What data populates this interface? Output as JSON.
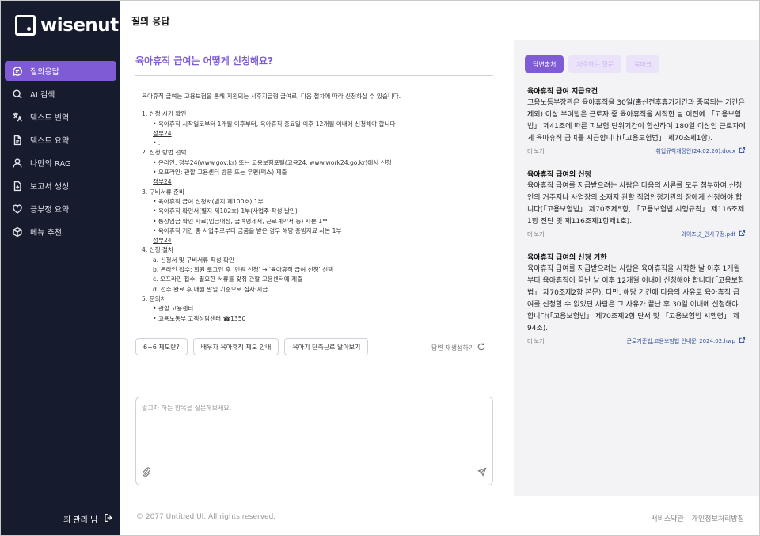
{
  "brand": {
    "name": "wisenut"
  },
  "header": {
    "title": "질의 응답"
  },
  "sidebar": {
    "items": [
      {
        "label": "질의응답",
        "icon": "chat-icon",
        "active": true
      },
      {
        "label": "AI 검색",
        "icon": "search-icon",
        "active": false
      },
      {
        "label": "텍스트 번역",
        "icon": "translate-icon",
        "active": false
      },
      {
        "label": "텍스트 요약",
        "icon": "document-icon",
        "active": false
      },
      {
        "label": "나만의 RAG",
        "icon": "user-icon",
        "active": false
      },
      {
        "label": "보고서 생성",
        "icon": "add-document-icon",
        "active": false
      },
      {
        "label": "긍부정 요약",
        "icon": "heart-icon",
        "active": false
      },
      {
        "label": "메뉴 추천",
        "icon": "cube-icon",
        "active": false
      }
    ],
    "user_label": "최 관리 님"
  },
  "question": {
    "title": "육아휴직 급여는 어떻게 신청해요?"
  },
  "answer": {
    "intro": "육아휴직 급여는 고용보험을 통해 지원되는 사후지급형 급여로, 다음 절차에 따라 신청하실 수 있습니다.",
    "s1": "1. 신청 시기 확인",
    "s1_a": "• 육아휴직 시작일로부터 1개월 이후부터, 육아휴직 종료일 이후 12개월 이내에 신청해야 합니다",
    "s1_b": "정부24",
    "s1_c": "• .",
    "s2": "2. 신청 방법 선택",
    "s2_a": "• 온라인: 정부24(www.gov.kr) 또는 고용보험포털(고용24, www.work24.go.kr)에서 신청",
    "s2_b": "• 오프라인: 관할 고용센터 방문 또는 우편(팩스) 제출",
    "s2_c": "정부24",
    "s3": "3. 구비서류 준비",
    "s3_a": "• 육아휴직 급여 신청서(별지 제100호) 1부",
    "s3_b": "• 육아휴직 확인서(별지 제102호) 1부(사업주 작성·날인)",
    "s3_c": "• 통상임금 확인 자료(임금대장, 급여명세서, 근로계약서 등) 사본 1부",
    "s3_d": "• 육아휴직 기간 중 사업주로부터 금품을 받은 경우 해당 증빙자료 사본 1부",
    "s3_e": "정부24",
    "s4": "4. 신청 절차",
    "s4_a": "a. 신청서 및 구비서류 작성·확인",
    "s4_b": "b. 온라인 접수: 회원 로그인 후 '민원 신청' → '육아휴직 급여 신청' 선택",
    "s4_c": "c. 오프라인 접수: 필요한 서류를 갖춰 관할 고용센터에 제출",
    "s4_d": "d. 접수 완료 후 매월 말일 기준으로 심사·지급",
    "s5": "5. 문의처",
    "s5_a": "• 관할 고용센터",
    "s5_b": "• 고용노동부 고객상담센터 ☎1350"
  },
  "chips": [
    "6+6 제도란?",
    "배우자 육아휴직 제도 안내",
    "육아기 단축근로 알아보기"
  ],
  "regenerate_label": "답변 재생성하기",
  "chat": {
    "placeholder": "알고자 하는 항목을 질문해보세요."
  },
  "right_tabs": [
    "답변출처",
    "자주하는 질문",
    "북마크"
  ],
  "refs": [
    {
      "title": "육아휴직 급여 지급요건",
      "body": "고용노동부장관은 육아휴직을 30일(출산전후휴가기간과 중복되는 기간은 제외) 이상 부여받은 근로자 중 육아휴직을 시작한 날 이전에 「고용보험법」 제41조에 따른 피보험 단위기간이 합산하여 180일 이상인 근로자에게 육아휴직 급여를 지급합니다(「고용보험법」 제70조제1항).",
      "more": "더 보기",
      "doc": "취업규칙개정안(24.02.26).docx"
    },
    {
      "title": "육아휴직 급여의 신청",
      "body": "육아휴직 급여를 지급받으려는 사람은 다음의 서류를 모두 첨부하여 신청인의 거주지나 사업장의 소재지 관할 직업안정기관의 장에게 신청해야 합니다(「고용보험법」 제70조제5항, 「고용보험법 시행규칙」 제116조제1항 전단 및 제116조제1항제1호).",
      "more": "더 보기",
      "doc": "와이즈넛_인사규정.pdf"
    },
    {
      "title": "육아휴직 급여의 신청 기한",
      "body": "육아휴직 급여를 지급받으려는 사람은 육아휴직을 시작한 날 이후 1개월부터 육아휴직이 끝난 날 이후 12개월 이내에 신청해야 합니다(「고용보험법」 제70조제2항 본문). 다만, 해당 기간에 다음의 사유로 육아휴직 급여를 신청할 수 없었던 사람은 그 사유가 끝난 후 30일 이내에 신청해야 합니다(「고용보험법」 제70조제2항 단서 및 「고용보험법 시행령」 제94조).",
      "more": "더 보기",
      "doc": "근로기준법,고용보험법 안내문_2024.02.hwp"
    }
  ],
  "footer": {
    "copyright": "© 2077 Untitled UI. All rights reserved.",
    "links": [
      "서비스약관",
      "개인정보처리방침"
    ]
  },
  "colors": {
    "accent": "#7f5bd6",
    "sidebar_bg": "#161b2e",
    "right_bg": "#f3f3f5",
    "doc_link": "#2e4f9e"
  }
}
